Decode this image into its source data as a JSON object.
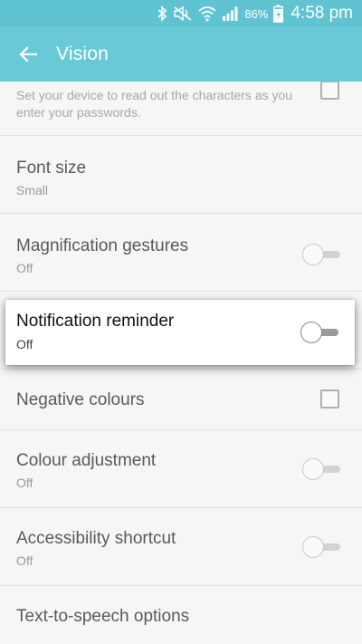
{
  "status_bar": {
    "battery_percent": "86%",
    "time": "4:58 pm",
    "icons": [
      "bluetooth-icon",
      "mute-icon",
      "wifi-icon",
      "signal-icon",
      "battery-charging-icon"
    ]
  },
  "app_bar": {
    "title": "Vision",
    "back_icon": "arrow-left-icon",
    "background_color": "#69c9d6"
  },
  "settings": {
    "speak_passwords": {
      "description": "Set your device to read out the characters as you enter your passwords.",
      "checked": false
    },
    "font_size": {
      "title": "Font size",
      "value": "Small"
    },
    "magnification_gestures": {
      "title": "Magnification gestures",
      "status": "Off",
      "enabled": false
    },
    "notification_reminder": {
      "title": "Notification reminder",
      "status": "Off",
      "enabled": false,
      "highlighted": true
    },
    "negative_colours": {
      "title": "Negative colours",
      "checked": false
    },
    "colour_adjustment": {
      "title": "Colour adjustment",
      "status": "Off",
      "enabled": false
    },
    "accessibility_shortcut": {
      "title": "Accessibility shortcut",
      "status": "Off",
      "enabled": false
    },
    "tts_options": {
      "title": "Text-to-speech options"
    }
  }
}
